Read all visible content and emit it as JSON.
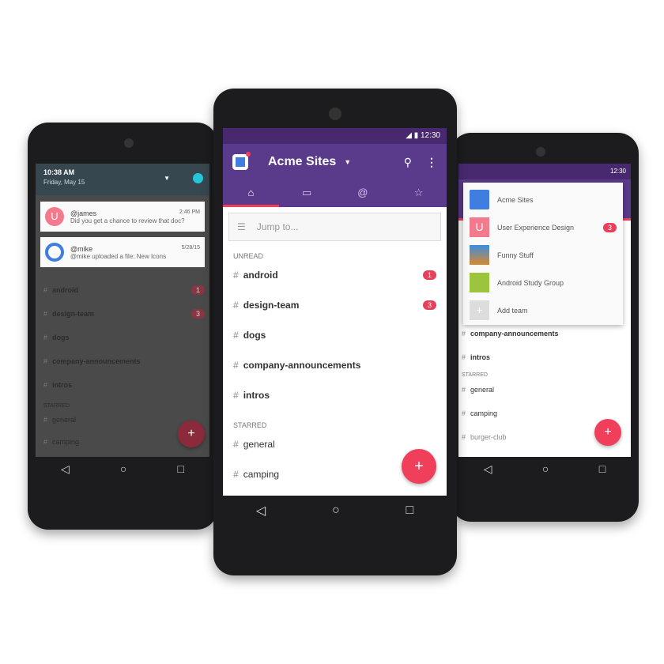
{
  "left": {
    "time": "10:38 AM",
    "date": "Friday, May 15",
    "notifications": [
      {
        "user": "@james",
        "time": "2:46 PM",
        "text": "Did you get a chance to review that doc?",
        "avatar": "U"
      },
      {
        "user": "@mike",
        "time": "5/28/15",
        "text": "@mike uploaded a file: New Icons"
      }
    ],
    "channels": [
      {
        "name": "android",
        "badge": "1"
      },
      {
        "name": "design-team",
        "badge": "3"
      },
      {
        "name": "dogs"
      },
      {
        "name": "company-announcements"
      },
      {
        "name": "intros"
      }
    ],
    "starred_label": "STARRED",
    "starred": [
      "general",
      "camping"
    ]
  },
  "center": {
    "status_time": "12:30",
    "team": "Acme Sites",
    "search_placeholder": "Jump to...",
    "unread_label": "UNREAD",
    "channels": [
      {
        "name": "android",
        "badge": "1"
      },
      {
        "name": "design-team",
        "badge": "3"
      },
      {
        "name": "dogs"
      },
      {
        "name": "company-announcements"
      },
      {
        "name": "intros"
      }
    ],
    "starred_label": "STARRED",
    "starred": [
      "general",
      "camping"
    ],
    "fab": "+"
  },
  "right": {
    "status_time": "12:30",
    "teams": [
      {
        "name": "Acme Sites",
        "color": "#3f7de0"
      },
      {
        "name": "User Experience Design",
        "badge": "3",
        "avatar": "U",
        "color": "#f27a8c"
      },
      {
        "name": "Funny Stuff",
        "color": "#d9882e"
      },
      {
        "name": "Android Study Group",
        "color": "#9bc53d"
      },
      {
        "name": "Add team",
        "avatar": "+",
        "color": "#ddd"
      }
    ],
    "channels": [
      "company-announcements",
      "intros"
    ],
    "starred_label": "STARRED",
    "starred": [
      "general",
      "camping",
      "burger-club"
    ],
    "fab": "+"
  },
  "colors": {
    "purple": "#5a3a8a",
    "purple_dark": "#48296f",
    "accent": "#ef3f5b"
  }
}
